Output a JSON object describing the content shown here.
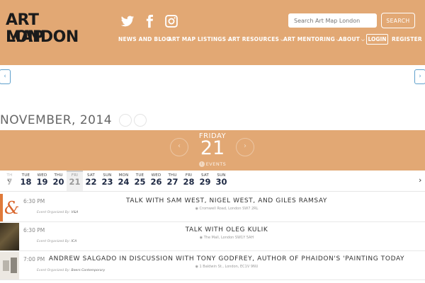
{
  "header": {
    "logo_line1": "ART MAP",
    "logo_line2": "LONDON",
    "social": [
      "twitter-icon",
      "facebook-icon",
      "instagram-icon"
    ],
    "search": {
      "placeholder": "Search Art Map London",
      "button_label": "SEARCH"
    },
    "nav": [
      {
        "label": "NEWS AND BLOG",
        "chevron": false
      },
      {
        "label": "ART MAP LISTINGS",
        "chevron": true
      },
      {
        "label": "ART RESOURCES",
        "chevron": true
      },
      {
        "label": "ART MENTORING",
        "chevron": true
      },
      {
        "label": "ABOUT",
        "chevron": true
      }
    ],
    "login_label": "LOGIN",
    "register_label": "REGISTER",
    "brand_color": "#e2a874"
  },
  "calendar": {
    "month_title": "NOVEMBER, 2014",
    "selected_day_name": "FRIDAY",
    "selected_day_number": "21",
    "events_label": "EVENTS",
    "prev_day_glyph": "‹",
    "next_day_glyph": "›",
    "days": [
      {
        "name": "TH",
        "num": "7",
        "state": "partial"
      },
      {
        "name": "TUE",
        "num": "18",
        "state": "normal"
      },
      {
        "name": "WED",
        "num": "19",
        "state": "normal"
      },
      {
        "name": "THU",
        "num": "20",
        "state": "normal"
      },
      {
        "name": "FRI",
        "num": "21",
        "state": "active"
      },
      {
        "name": "SAT",
        "num": "22",
        "state": "normal"
      },
      {
        "name": "SUN",
        "num": "23",
        "state": "normal"
      },
      {
        "name": "MON",
        "num": "24",
        "state": "normal"
      },
      {
        "name": "TUE",
        "num": "25",
        "state": "normal"
      },
      {
        "name": "WED",
        "num": "26",
        "state": "normal"
      },
      {
        "name": "THU",
        "num": "27",
        "state": "normal"
      },
      {
        "name": "FRI",
        "num": "28",
        "state": "normal"
      },
      {
        "name": "SAT",
        "num": "29",
        "state": "normal"
      },
      {
        "name": "SUN",
        "num": "30",
        "state": "normal"
      }
    ]
  },
  "events": [
    {
      "time": "6:30 PM",
      "organizer_prefix": "Event Organized By:",
      "organizer": "V&A",
      "title": "TALK WITH SAM WEST, NIGEL WEST, AND GILES RAMSAY",
      "location": "Cromwell Road, London SW7 2RL"
    },
    {
      "time": "6:30 PM",
      "organizer_prefix": "Event Organized By:",
      "organizer": "ICA",
      "title": "TALK WITH OLEG KULIK",
      "location": "The Mall, London SW1Y 5AH"
    },
    {
      "time": "7:00 PM",
      "organizer_prefix": "Event Organized By:",
      "organizer": "Beers Contemporary",
      "title": "ANDREW SALGADO IN DISCUSSION WITH TONY GODFREY, AUTHOR OF PHAIDON'S 'PAINTING TODAY",
      "location": "1 Baldwin St., London, EC1V 9NU"
    }
  ]
}
